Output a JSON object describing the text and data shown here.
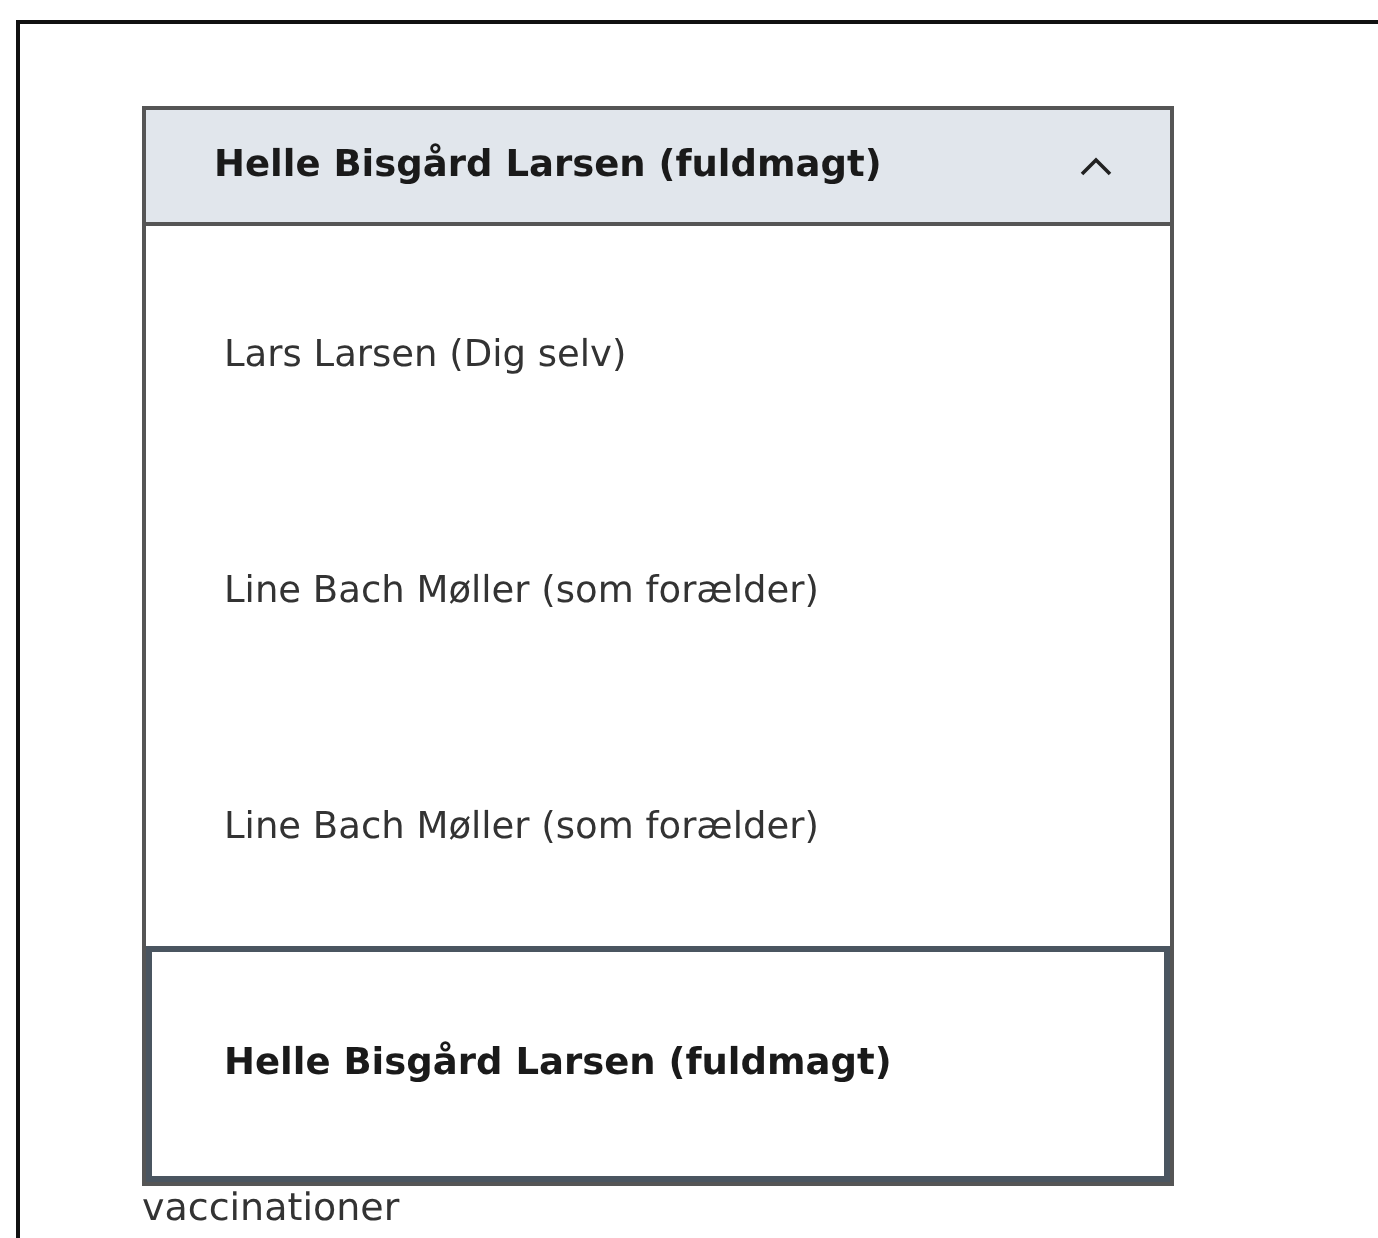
{
  "dropdown": {
    "label": "Helle Bisgård Larsen (fuldmagt)",
    "expanded": true,
    "options": [
      {
        "label": "Lars Larsen (Dig selv)",
        "selected": false
      },
      {
        "label": "Line Bach Møller (som forælder)",
        "selected": false
      },
      {
        "label": "Line Bach Møller (som forælder)",
        "selected": false
      },
      {
        "label": "Helle Bisgård Larsen (fuldmagt)",
        "selected": true
      }
    ]
  },
  "below_text": "vaccinationer"
}
